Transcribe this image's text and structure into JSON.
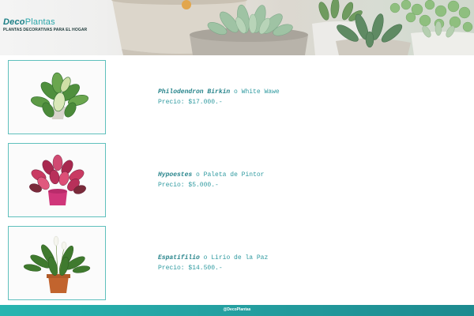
{
  "header": {
    "brand_part1": "Deco",
    "brand_part2": "Plantas",
    "tagline": "PLANTAS DECORATIVAS PARA EL HOGAR"
  },
  "products": [
    {
      "name": "Philodendron Birkin",
      "separator": "o",
      "alt_name": "White Wawe",
      "price": "Precio: $17.000.-"
    },
    {
      "name": "Hypoestes",
      "separator": "o",
      "alt_name": "Paleta de Pintor",
      "price": "Precio: $5.000.-"
    },
    {
      "name": "Espatifilio",
      "separator": "o",
      "alt_name": "Lirio de la Paz",
      "price": "Precio: $14.500.-"
    }
  ],
  "footer": {
    "text": "@DecoPlantas"
  },
  "colors": {
    "accent": "#2aa5a9",
    "border": "#5fc0bd",
    "footer": "#249fa0"
  },
  "icons": [
    "succulents-hero-image",
    "philodendron-image",
    "hypoestes-image",
    "peace-lily-image"
  ]
}
